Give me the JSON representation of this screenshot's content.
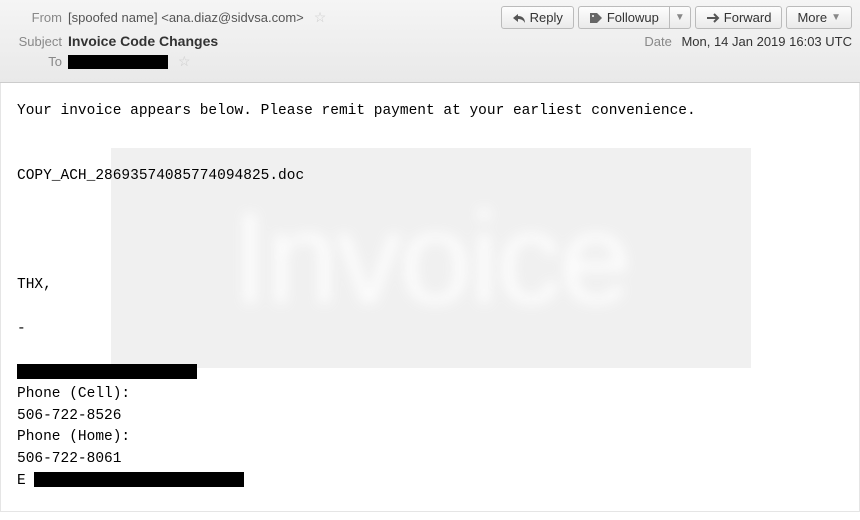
{
  "header": {
    "from_label": "From",
    "from_value": "[spoofed name] <ana.diaz@sidvsa.com>",
    "subject_label": "Subject",
    "subject_value": "Invoice Code Changes",
    "to_label": "To",
    "date_label": "Date",
    "date_value": "Mon, 14 Jan 2019 16:03 UTC"
  },
  "toolbar": {
    "reply_label": "Reply",
    "followup_label": "Followup",
    "forward_label": "Forward",
    "more_label": "More"
  },
  "body": {
    "line1": "Your invoice appears below. Please remit payment at your earliest convenience.",
    "attachment": "COPY_ACH_28693574085774094825.doc",
    "thx": "THX,",
    "dash": "-",
    "phone_cell_label": "Phone (Cell):",
    "phone_cell_value": "506-722-8526",
    "phone_home_label": "Phone (Home):",
    "phone_home_value": "506-722-8061",
    "email_label": "E"
  },
  "watermark": "Invoice"
}
